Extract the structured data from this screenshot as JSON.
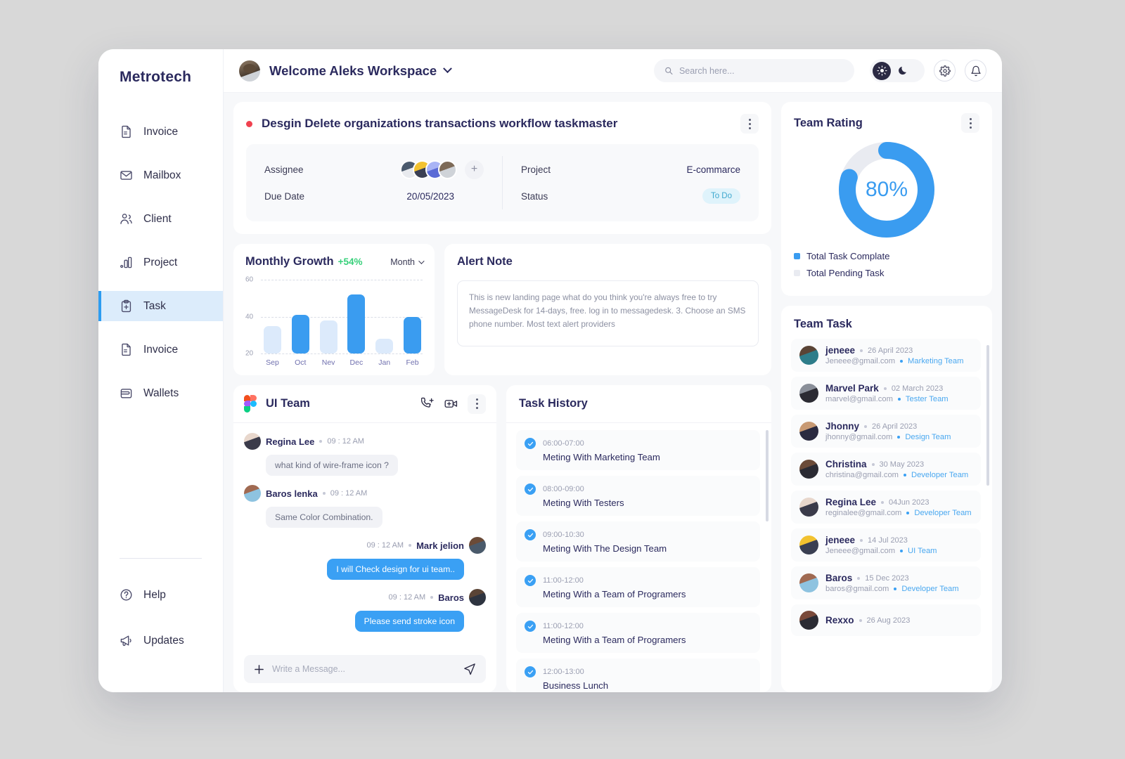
{
  "brand": "Metrotech",
  "sidebar": {
    "items": [
      {
        "label": "Invoice",
        "icon": "document-icon"
      },
      {
        "label": "Mailbox",
        "icon": "envelope-icon"
      },
      {
        "label": "Client",
        "icon": "users-icon"
      },
      {
        "label": "Project",
        "icon": "bar-chart-icon"
      },
      {
        "label": "Task",
        "icon": "clipboard-icon",
        "active": true
      },
      {
        "label": "Invoice",
        "icon": "document-icon"
      },
      {
        "label": "Wallets",
        "icon": "wallet-icon"
      }
    ],
    "bottom": [
      {
        "label": "Help",
        "icon": "question-circle-icon"
      },
      {
        "label": "Updates",
        "icon": "megaphone-icon"
      }
    ]
  },
  "header": {
    "title": "Welcome Aleks Workspace",
    "search_placeholder": "Search here...",
    "search_value": "",
    "theme_light": "sun-icon",
    "theme_dark": "moon-icon",
    "settings": "gear-icon",
    "notifications": "bell-icon"
  },
  "task_summary": {
    "title": "Desgin Delete organizations transactions workflow taskmaster",
    "assignee_label": "Assignee",
    "due_date_label": "Due Date",
    "due_date_value": "20/05/2023",
    "project_label": "Project",
    "project_value": "E-commarce",
    "status_label": "Status",
    "status_value": "To Do",
    "add_assignee": "+"
  },
  "growth": {
    "title": "Monthly Growth",
    "percent": "+54%",
    "selector": "Month"
  },
  "chart_data": {
    "type": "bar",
    "title": "Monthly Growth",
    "categories": [
      "Sep",
      "Oct",
      "Nev",
      "Dec",
      "Jan",
      "Feb"
    ],
    "values": [
      35,
      41,
      38,
      52,
      28,
      40
    ],
    "highlighted": [
      false,
      true,
      false,
      true,
      false,
      true
    ],
    "yticks": [
      20,
      40,
      60
    ],
    "ylim": [
      20,
      60
    ],
    "xlabel": "",
    "ylabel": "",
    "grid": true,
    "colors": {
      "active": "#3a9cf0",
      "inactive": "#dceafb"
    }
  },
  "alert": {
    "title": "Alert Note",
    "text": "This is new landing page what do you think you're always free to try MessageDesk for 14-days, free. log in to messagedesk. 3. Choose an SMS phone number. Most text alert providers"
  },
  "chat": {
    "name": "UI Team",
    "input_placeholder": "Write a Message...",
    "input_value": "",
    "messages": [
      {
        "name": "Regina Lee",
        "time": "09 : 12 AM",
        "text": "what kind of wire-frame icon ?",
        "out": false
      },
      {
        "name": "Baros lenka",
        "time": "09 : 12 AM",
        "text": "Same Color Combination.",
        "out": false
      },
      {
        "name": "Mark jelion",
        "time": "09 : 12 AM",
        "text": "I will Check design for ui team..",
        "out": true
      },
      {
        "name": "Baros",
        "time": "09 : 12 AM",
        "text": "Please send stroke icon",
        "out": true
      }
    ]
  },
  "history": {
    "title": "Task History",
    "items": [
      {
        "time": "06:00-07:00",
        "label": "Meting With Marketing Team"
      },
      {
        "time": "08:00-09:00",
        "label": "Meting With Testers"
      },
      {
        "time": "09:00-10:30",
        "label": "Meting With The Design Team"
      },
      {
        "time": "11:00-12:00",
        "label": "Meting With a Team of Programers"
      },
      {
        "time": "11:00-12:00",
        "label": "Meting With a Team of Programers"
      },
      {
        "time": "12:00-13:00",
        "label": "Business Lunch"
      }
    ]
  },
  "rating": {
    "title": "Team Rating",
    "percent": "80%",
    "value": 80,
    "legend": [
      {
        "label": "Total Task Complate",
        "color": "#3a9cf0"
      },
      {
        "label": "Total Pending Task",
        "color": "#e9ebf1"
      }
    ]
  },
  "team_task": {
    "title": "Team Task",
    "items": [
      {
        "name": "jeneee",
        "date": "26 April 2023",
        "email": "Jeneee@gmail.com",
        "team": "Marketing Team"
      },
      {
        "name": "Marvel Park",
        "date": "02 March 2023",
        "email": "marvel@gmail.com",
        "team": "Tester Team"
      },
      {
        "name": "Jhonny",
        "date": "26 April 2023",
        "email": "jhonny@gmail.com",
        "team": "Design Team"
      },
      {
        "name": "Christina",
        "date": "30 May 2023",
        "email": "christina@gmail.com",
        "team": "Developer Team"
      },
      {
        "name": "Regina Lee",
        "date": "04Jun 2023",
        "email": "reginalee@gmail.com",
        "team": "Developer Team"
      },
      {
        "name": "jeneee",
        "date": "14 Jul 2023",
        "email": "Jeneee@gmail.com",
        "team": "UI Team"
      },
      {
        "name": "Baros",
        "date": "15 Dec 2023",
        "email": "baros@gmail.com",
        "team": "Developer Team"
      },
      {
        "name": "Rexxo",
        "date": "26 Aug 2023",
        "email": "",
        "team": ""
      }
    ]
  }
}
